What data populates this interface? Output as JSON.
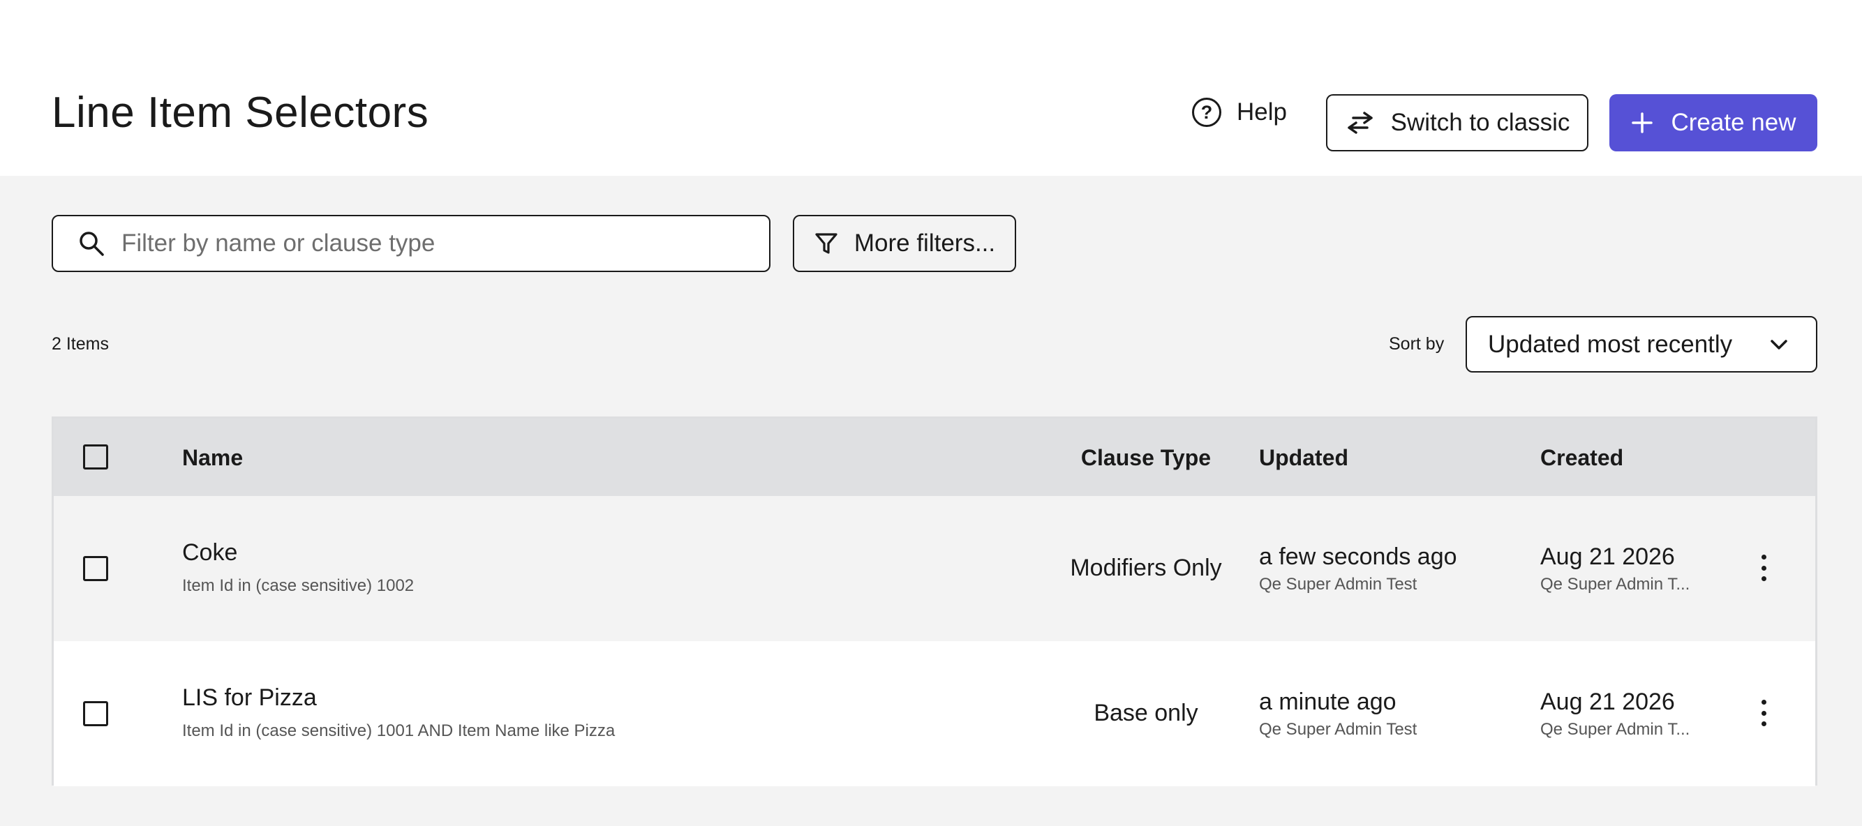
{
  "header": {
    "title": "Line Item Selectors",
    "help_label": "Help",
    "switch_label": "Switch to classic",
    "create_label": "Create new"
  },
  "toolbar": {
    "search_placeholder": "Filter by name or clause type",
    "search_value": "",
    "filters_label": "More filters..."
  },
  "summary": {
    "count_label": "2 Items",
    "sort_label": "Sort by",
    "sort_value": "Updated most recently"
  },
  "table": {
    "columns": [
      "Name",
      "Clause Type",
      "Updated",
      "Created"
    ],
    "rows": [
      {
        "name": "Coke",
        "description": "Item Id in (case sensitive) 1002",
        "clause_type": "Modifiers Only",
        "updated": "a few seconds ago",
        "updated_by": "Qe Super Admin Test",
        "created": "Aug 21 2026",
        "created_by": "Qe Super Admin T..."
      },
      {
        "name": "LIS for Pizza",
        "description": "Item Id in (case sensitive) 1001 AND Item Name like Pizza",
        "clause_type": "Base only",
        "updated": "a minute ago",
        "updated_by": "Qe Super Admin Test",
        "created": "Aug 21 2026",
        "created_by": "Qe Super Admin T..."
      }
    ]
  },
  "colors": {
    "primary": "#5651d6",
    "page_background": "#f3f3f3",
    "header_row": "#dfe0e2"
  },
  "icons": [
    "help-icon",
    "swap-arrows-icon",
    "plus-icon",
    "search-icon",
    "filter-funnel-icon",
    "chevron-down-icon",
    "more-vertical-icon"
  ]
}
